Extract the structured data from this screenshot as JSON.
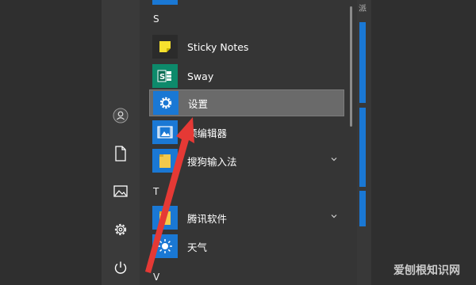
{
  "sections": {
    "s": "S",
    "t": "T",
    "v": "V"
  },
  "apps": {
    "sticky_notes": "Sticky Notes",
    "sway": "Sway",
    "settings": "设置",
    "video_editor": "频编辑器",
    "sogou_input": "搜狗输入法",
    "tencent_software": "腾讯软件",
    "weather": "天气"
  },
  "rail_icons": [
    "user-icon",
    "document-icon",
    "pictures-icon",
    "gear-icon",
    "power-icon"
  ],
  "corner_label": "派",
  "watermark": "爱刨根知识网",
  "colors": {
    "accent_blue": "#1a78d4",
    "folder_yellow": "#f2c94c",
    "sticky_yellow": "#f7e12e",
    "sway_green": "#0d8a6b",
    "arrow_red": "#e53935"
  }
}
